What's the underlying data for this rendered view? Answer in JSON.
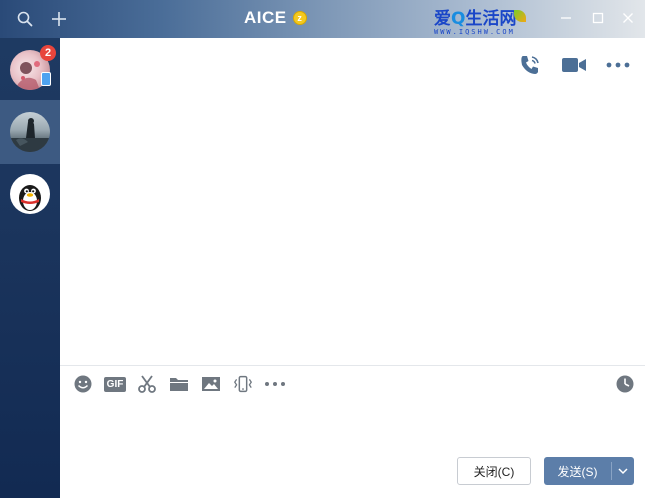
{
  "window": {
    "title": "AICE",
    "title_badge": "z"
  },
  "watermark": {
    "main_left": "爱",
    "main_q": "Q",
    "main_right": "生活网",
    "sub": "WWW.IQSHW.COM"
  },
  "contacts": [
    {
      "name": "contact-1",
      "unread": "2",
      "has_mobile": true
    },
    {
      "name": "contact-2",
      "selected": true
    },
    {
      "name": "contact-3"
    }
  ],
  "top_actions": [
    "phone-call-icon",
    "video-call-icon",
    "more-icon"
  ],
  "toolbar": {
    "tools": [
      "emoji-icon",
      "gif-icon",
      "scissors-icon",
      "folder-icon",
      "image-icon",
      "shake-icon",
      "more-dots-icon"
    ],
    "gif_label": "GIF",
    "history": "clock-icon"
  },
  "buttons": {
    "close_label": "关闭(C)",
    "send_label": "发送(S)"
  },
  "colors": {
    "sidebar": "#1b355d",
    "send_button": "#5c7ea9",
    "unread_badge": "#e8453c",
    "icon_gray": "#5e6670"
  }
}
